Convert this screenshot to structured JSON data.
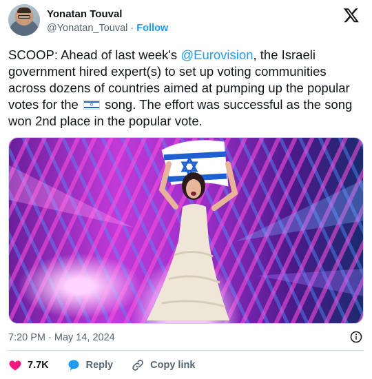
{
  "author": {
    "name": "Yonatan Touval",
    "handle": "@Yonatan_Touval",
    "separator": "·",
    "follow_label": "Follow"
  },
  "tweet": {
    "text_before_mention": "SCOOP: Ahead of last week's ",
    "mention": "@Eurovision",
    "text_after_mention": ", the Israeli government hired expert(s) to set up voting communities across dozens of countries aimed at pumping up the popular votes for the ",
    "text_after_flag": " song. The effort was successful as the song won 2nd place in the popular vote.",
    "flag_icon": "israel-flag-emoji"
  },
  "timestamp": "7:20 PM · May 14, 2024",
  "actions": {
    "likes": "7.7K",
    "reply_label": "Reply",
    "copy_link_label": "Copy link"
  },
  "colors": {
    "accent": "#1d9bf0",
    "like": "#f91880",
    "muted": "#536471"
  }
}
